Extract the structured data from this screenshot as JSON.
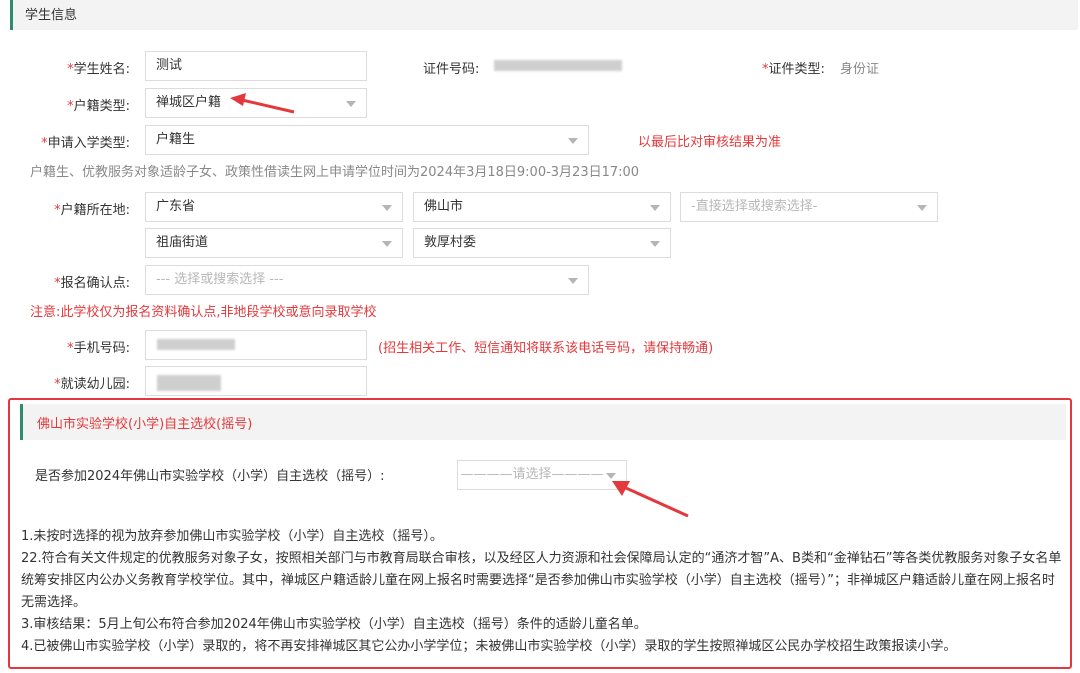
{
  "section": {
    "title": "学生信息"
  },
  "required_mark": "*",
  "fields": {
    "name": {
      "label": "学生姓名:",
      "value": "测试"
    },
    "id_number": {
      "label": "证件号码:"
    },
    "id_type": {
      "label": "证件类型:",
      "value": "身份证"
    },
    "household_type": {
      "label": "户籍类型:",
      "value": "禅城区户籍"
    },
    "apply_type": {
      "label": "申请入学类型:",
      "value": "户籍生",
      "note": "以最后比对审核结果为准"
    },
    "apply_period_note": "户籍生、优教服务对象适龄子女、政策性借读生网上申请学位时间为2024年3月18日9:00-3月23日17:00",
    "household_location": {
      "label": "户籍所在地:",
      "province": "广东省",
      "city": "佛山市",
      "district_placeholder": "-直接选择或搜索选择-",
      "street": "祖庙街道",
      "committee": "敦厚村委"
    },
    "confirm_point": {
      "label": "报名确认点:",
      "placeholder": "--- 选择或搜索选择 ---",
      "note": "注意:此学校仅为报名资料确认点,非地段学校或意向录取学校"
    },
    "phone": {
      "label": "手机号码:",
      "note": "(招生相关工作、短信通知将联系该电话号码，请保持畅通)"
    },
    "kindergarten": {
      "label": "就读幼儿园:"
    }
  },
  "lottery": {
    "title": "佛山市实验学校(小学)自主选校(摇号)",
    "question": "是否参加2024年佛山市实验学校（小学）自主选校（摇号）:",
    "select_placeholder": "————请选择————",
    "notes": [
      "1.未按时选择的视为放弃参加佛山市实验学校（小学）自主选校（摇号）。",
      "22.符合有关文件规定的优教服务对象子女，按照相关部门与市教育局联合审核，以及经区人力资源和社会保障局认定的“通济才智”A、B类和“金禅钻石”等各类优教服务对象子女名单统筹安排区内公办义务教育学校学位。其中，禅城区户籍适龄儿童在网上报名时需要选择“是否参加佛山市实验学校（小学）自主选校（摇号）”；非禅城区户籍适龄儿童在网上报名时无需选择。",
      "3.审核结果：5月上旬公布符合参加2024年佛山市实验学校（小学）自主选校（摇号）条件的适龄儿童名单。",
      "4.已被佛山市实验学校（小学）录取的，将不再安排禅城区其它公办小学学位；未被佛山市实验学校（小学）录取的学生按照禅城区公民办学校招生政策报读小学。"
    ]
  },
  "colors": {
    "accent": "#2e8b6e",
    "required": "#e4393c",
    "annotation": "#e4393c"
  }
}
